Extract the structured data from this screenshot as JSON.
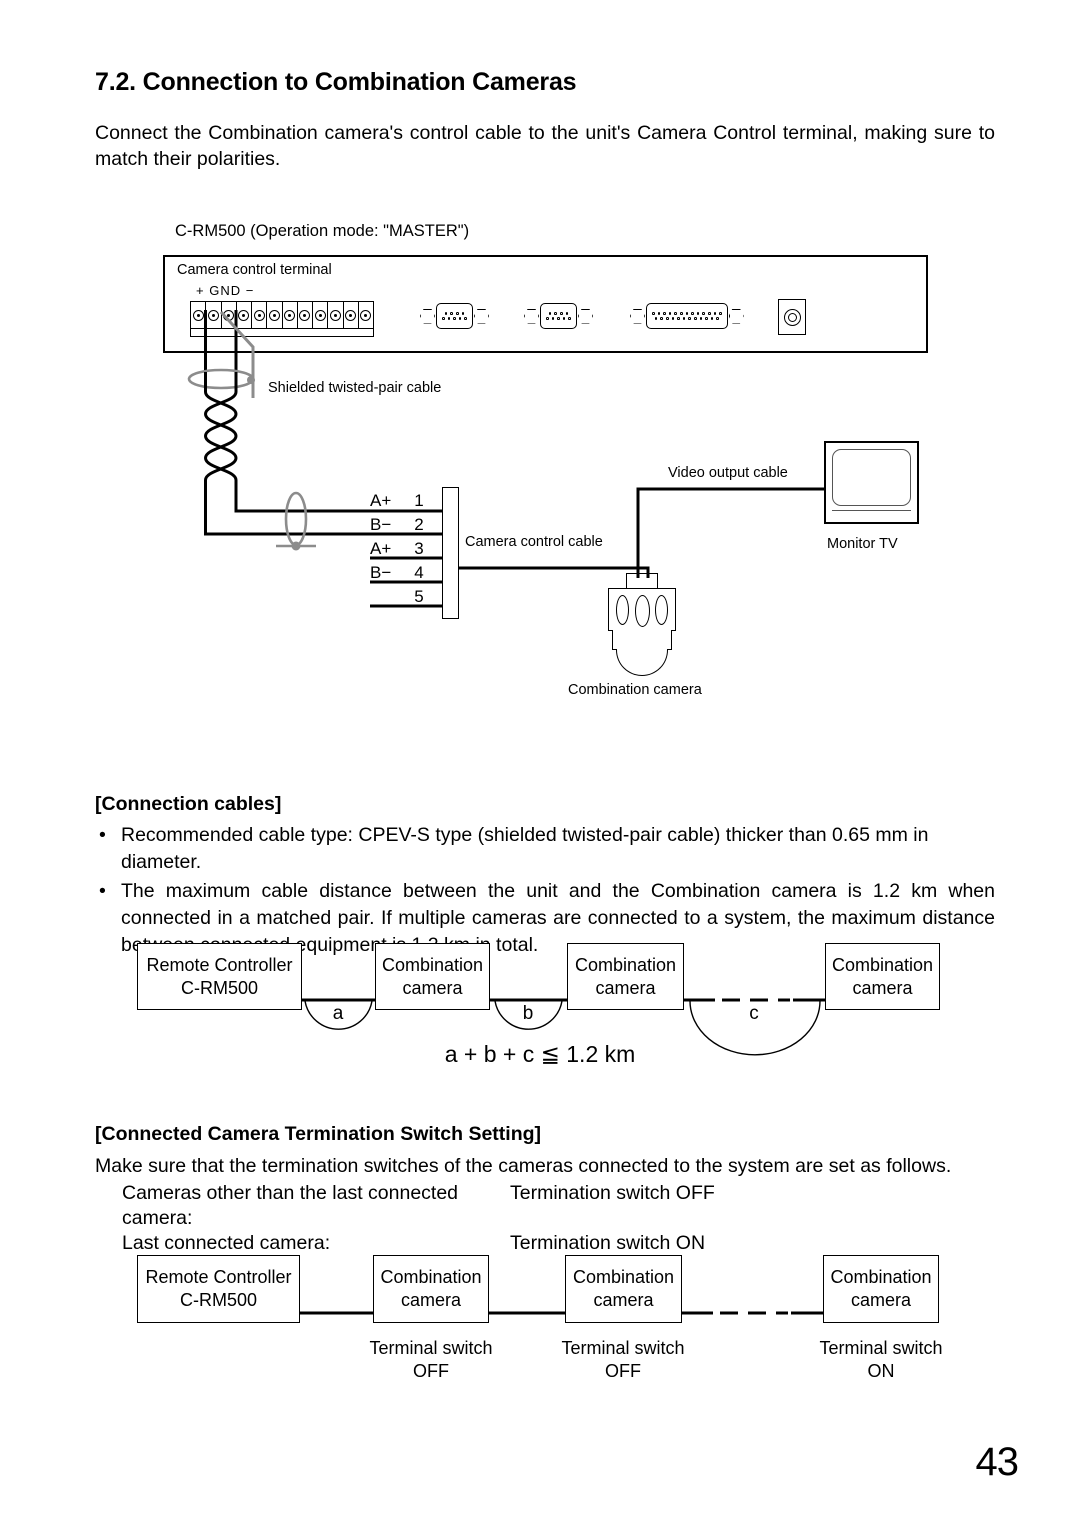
{
  "document": {
    "section_title": "7.2. Connection to Combination Cameras",
    "intro": "Connect the Combination camera's control cable to the unit's Camera Control terminal, making sure to match their polarities.",
    "page_number": "43"
  },
  "main_diagram": {
    "device_caption": "C-RM500 (Operation mode: \"MASTER\")",
    "terminal_label": "Camera control terminal",
    "polarity_label": "+ GND −",
    "terminal_screw_count": 12,
    "shielded_cable_label": "Shielded twisted-pair cable",
    "camera_control_cable_label": "Camera control cable",
    "video_output_cable_label": "Video output cable",
    "monitor_label": "Monitor TV",
    "camera_label": "Combination camera",
    "pins": [
      {
        "label": "A+",
        "number": "1"
      },
      {
        "label": "B−",
        "number": "2"
      },
      {
        "label": "A+",
        "number": "3"
      },
      {
        "label": "B−",
        "number": "4"
      },
      {
        "label": "",
        "number": "5"
      }
    ],
    "connectors": [
      {
        "type": "db9",
        "pin_rows": [
          4,
          5
        ]
      },
      {
        "type": "db9",
        "pin_rows": [
          4,
          5
        ]
      },
      {
        "type": "db25",
        "pin_rows": [
          13,
          12
        ]
      },
      {
        "type": "bnc"
      }
    ]
  },
  "connection_cables": {
    "heading": "[Connection cables]",
    "bullets": [
      "Recommended cable type: CPEV-S type (shielded twisted-pair cable) thicker than 0.65 mm in diameter.",
      "The maximum cable distance between the unit and the Combination camera is 1.2 km when connected in a matched pair. If multiple cameras are connected to a system, the maximum distance between connected equipment is 1.2 km in total."
    ],
    "bullet_marker": "•"
  },
  "distance_diagram": {
    "blocks": [
      {
        "line1": "Remote Controller",
        "line2": "C-RM500"
      },
      {
        "line1": "Combination",
        "line2": "camera"
      },
      {
        "line1": "Combination",
        "line2": "camera"
      },
      {
        "line1": "Combination",
        "line2": "camera"
      }
    ],
    "segment_labels": [
      "a",
      "b",
      "c"
    ],
    "formula": "a + b + c ≦ 1.2 km"
  },
  "termination": {
    "heading": "[Connected Camera Termination Switch Setting]",
    "intro": "Make sure that the termination switches of the cameras connected to the system are set as follows.",
    "rules": [
      {
        "condition": "Cameras other than the last connected camera:",
        "setting": "Termination switch OFF"
      },
      {
        "condition": "Last connected camera:",
        "setting": "Termination switch ON"
      }
    ],
    "blocks": [
      {
        "line1": "Remote Controller",
        "line2": "C-RM500"
      },
      {
        "line1": "Combination",
        "line2": "camera"
      },
      {
        "line1": "Combination",
        "line2": "camera"
      },
      {
        "line1": "Combination",
        "line2": "camera"
      }
    ],
    "switch_labels": [
      {
        "line1": "Terminal switch",
        "line2": "OFF"
      },
      {
        "line1": "Terminal switch",
        "line2": "OFF"
      },
      {
        "line1": "Terminal switch",
        "line2": "ON"
      }
    ]
  },
  "colors": {
    "ink": "#000000",
    "paper": "#ffffff",
    "shield_gray": "#8c8c8c"
  }
}
